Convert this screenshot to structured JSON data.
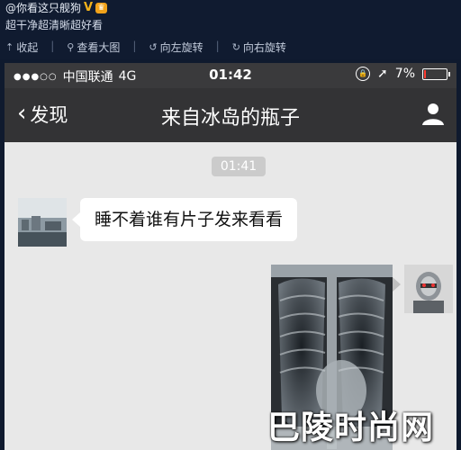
{
  "weibo": {
    "username": "@你看这只舰狗",
    "vip_mark": "V",
    "post_text": "超干净超清晰超好看",
    "toolbar": {
      "collapse": "收起",
      "view_large": "查看大图",
      "rotate_left": "向左旋转",
      "rotate_right": "向右旋转"
    }
  },
  "phone": {
    "status_bar": {
      "carrier": "中国联通",
      "network": "4G",
      "time": "01:42",
      "battery": "7%",
      "battery_level": 0.07,
      "battery_color": "#ff3b30"
    },
    "nav": {
      "back_label": "发现",
      "title": "来自冰岛的瓶子"
    },
    "chat": {
      "timestamp": "01:41",
      "messages": [
        {
          "from": "other",
          "text": "睡不着谁有片子发来看看"
        },
        {
          "from": "self",
          "type": "image",
          "image": "chest-xray"
        }
      ]
    }
  },
  "watermark": "巴陵时尚网",
  "colors": {
    "weibo_bg": "#101b30",
    "nav_bg": "#333335",
    "chat_bg": "#e8e8e8",
    "bubble_bg": "#ffffff"
  }
}
